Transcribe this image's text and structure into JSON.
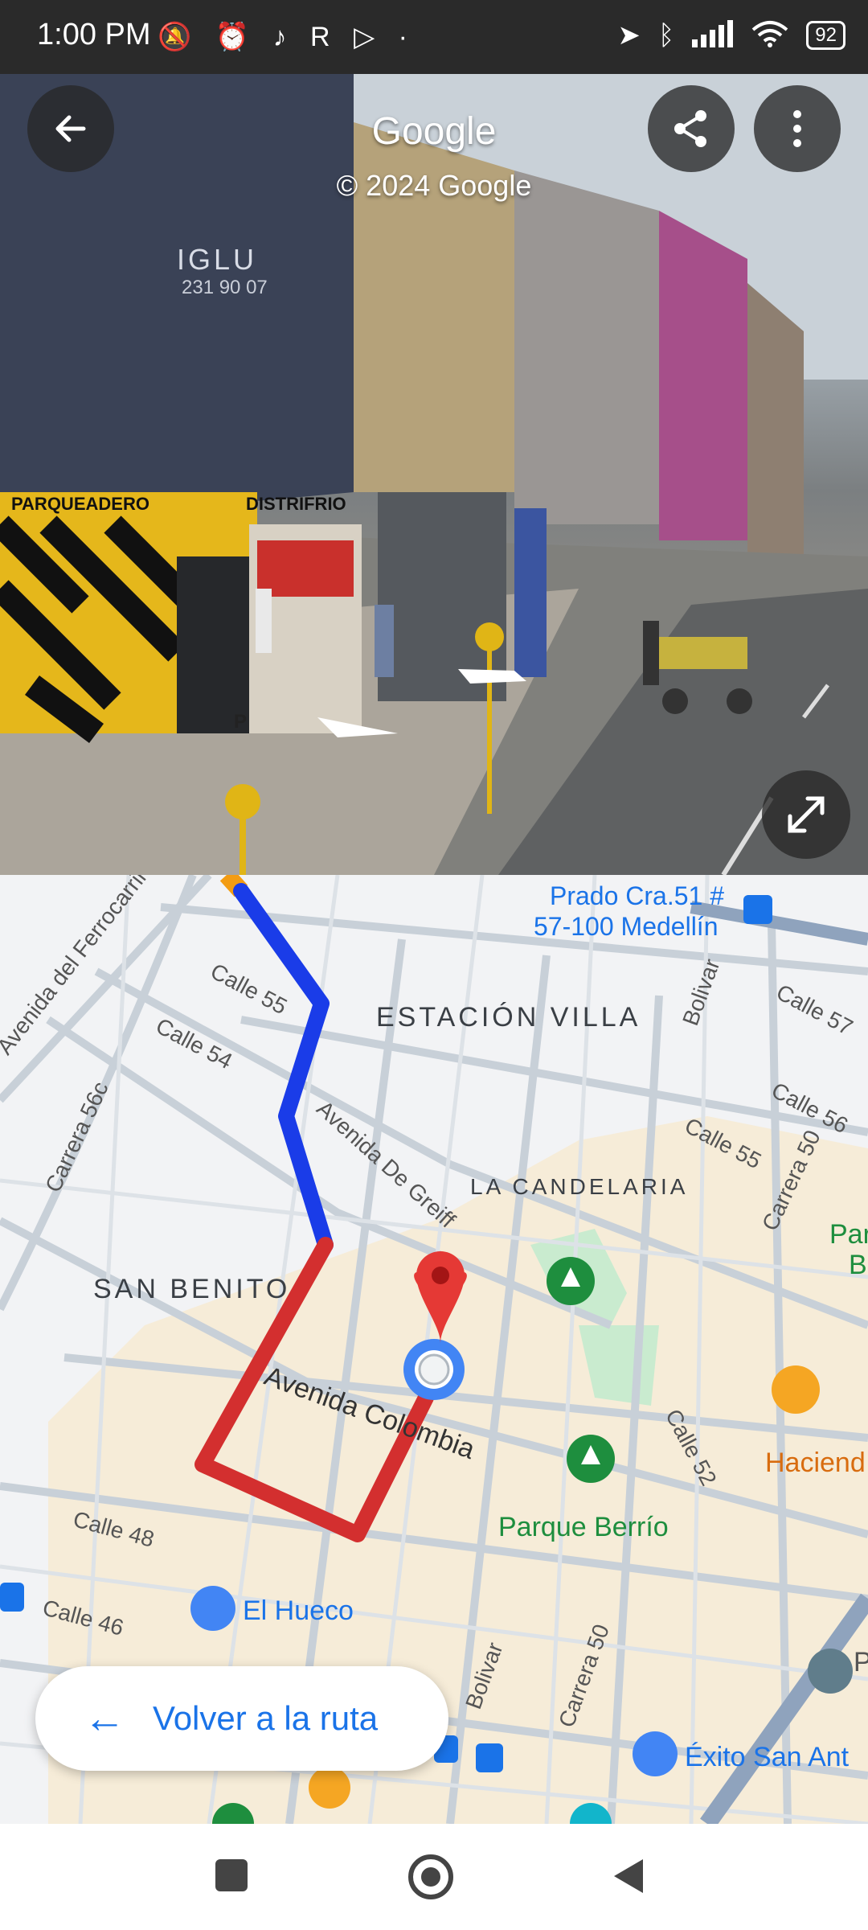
{
  "status_bar": {
    "time": "1:00 PM",
    "left_icons": [
      "mute-icon",
      "alarm-icon",
      "tiktok-icon",
      "r-app-icon",
      "play-icon",
      "dot-icon"
    ],
    "right_icons": [
      "location-icon",
      "bluetooth-icon",
      "signal-icon",
      "wifi-icon"
    ],
    "battery": "92"
  },
  "street_view": {
    "title": "Google",
    "copyright": "© 2024 Google",
    "signs": {
      "iglu": "IGLU",
      "iglu_phone": "231 90 07",
      "parqueadero": "PARQUEADERO",
      "distrifrio": "DISTRIFRIO",
      "parking_p": "P"
    }
  },
  "map": {
    "areas": {
      "estacion_villa": "ESTACIÓN VILLA",
      "la_candelaria": "LA CANDELARIA",
      "san_benito": "SAN BENITO"
    },
    "streets": {
      "avenida_ferrocarril": "Avenida del Ferrocarril",
      "calle55_left": "Calle 55",
      "calle54": "Calle 54",
      "carrera56c": "Carrera 56c",
      "avenida_greiff": "Avenida De Greiff",
      "avenida_colombia": "Avenida Colombia",
      "calle48": "Calle 48",
      "calle46": "Calle 46",
      "bolivar_top": "Bolivar",
      "bolivar_bottom": "Bolivar",
      "carrera50_top": "Carrera 50",
      "carrera50_bottom": "Carrera 50",
      "calle57": "Calle 57",
      "calle56": "Calle 56",
      "calle55_right": "Calle 55",
      "calle52": "Calle 52"
    },
    "pois": {
      "prado_line1": "Prado Cra.51 #",
      "prado_line2": "57-100 Medellín",
      "parque_berrio": "Parque Berrío",
      "el_hueco": "El Hueco",
      "hacienda": "Haciend",
      "exito": "Éxito San Ant",
      "par_cut1": "Par",
      "par_cut2": "B",
      "right_cut": "P"
    },
    "route_colors": {
      "blue": "#1a3ce8",
      "red": "#d32f2f",
      "orange": "#f39c12"
    },
    "back_to_route": "Volver a la ruta"
  },
  "nav_bar": {
    "icons": [
      "recents-square-icon",
      "home-circle-icon",
      "back-triangle-icon"
    ]
  }
}
